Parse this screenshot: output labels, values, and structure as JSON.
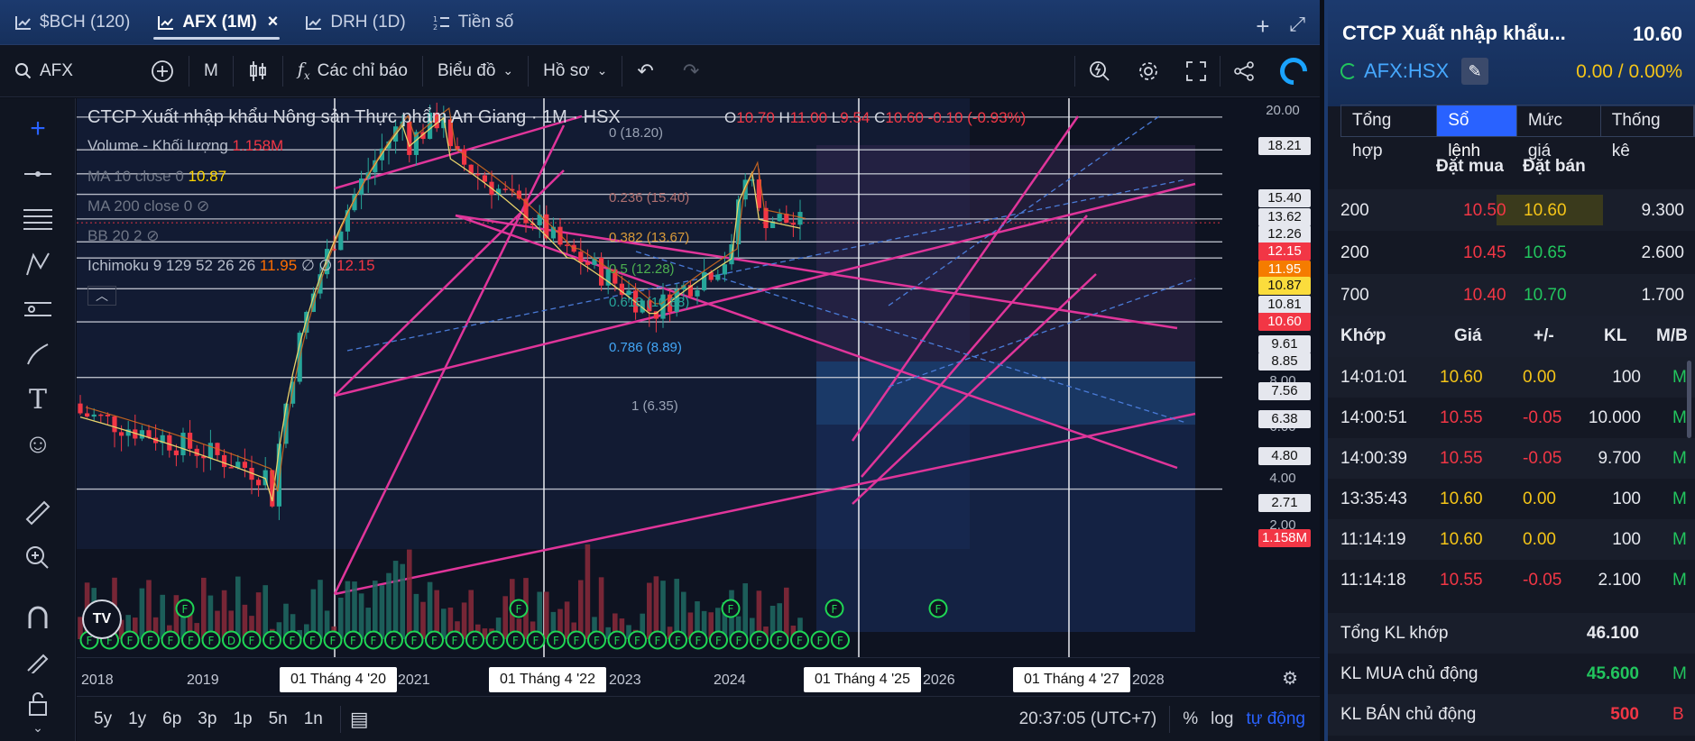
{
  "tabs": [
    {
      "label": "$BCH (120)"
    },
    {
      "label": "AFX (1M)",
      "active": true
    },
    {
      "label": "DRH (1D)"
    },
    {
      "label": "Tiền số"
    }
  ],
  "toolbar": {
    "symbol": "AFX",
    "interval": "M",
    "indicators": "Các chỉ báo",
    "chart_type": "Biểu đồ",
    "profile": "Hồ sơ"
  },
  "legend": {
    "title": "CTCP Xuất nhập khẩu Nông sản Thực phẩm An Giang · 1M · HSX",
    "ohlc": {
      "o_label": "O",
      "o": "10.70",
      "h_label": "H",
      "h": "11.00",
      "l_label": "L",
      "l": "9.54",
      "c_label": "C",
      "c": "10.60",
      "chg": "-0.10 (-0.93%)"
    },
    "volume_label": "Volume - Khối lượng",
    "volume_value": "1.158M",
    "ma10_label": "MA 10 close 0",
    "ma10_value": "10.87",
    "ma200_label": "MA 200 close 0",
    "bb_label": "BB 20 2",
    "ichimoku_label": "Ichimoku 9 129 52 26 26",
    "ichimoku_v1": "11.95",
    "ichimoku_sym1": "∅",
    "ichimoku_sym2": "∅",
    "ichimoku_v2": "12.15"
  },
  "fib_levels": [
    {
      "label": "0 (18.20)",
      "color": "#9aa3b5"
    },
    {
      "label": "0.236 (15.40)",
      "color": "#b07070"
    },
    {
      "label": "0.382 (13.67)",
      "color": "#d89a3a"
    },
    {
      "label": "0.5 (12.28)",
      "color": "#4caf50"
    },
    {
      "label": "0.618 (10.88)",
      "color": "#26a69a"
    },
    {
      "label": "0.786 (8.89)",
      "color": "#42a5f5"
    },
    {
      "label": "1 (6.35)",
      "color": "#9aa3b5"
    }
  ],
  "price_axis": {
    "ticks": [
      "20.00",
      "10.00",
      "8.00",
      "6.00",
      "4.00",
      "2.00"
    ],
    "labels": [
      {
        "text": "18.21",
        "style": "w"
      },
      {
        "text": "15.40",
        "style": "w"
      },
      {
        "text": "13.62",
        "style": "w"
      },
      {
        "text": "12.26",
        "style": "w"
      },
      {
        "text": "12.15",
        "style": "red"
      },
      {
        "text": "11.95",
        "style": "orange"
      },
      {
        "text": "10.87",
        "style": "yel"
      },
      {
        "text": "10.81",
        "style": "w"
      },
      {
        "text": "10.60",
        "style": "red"
      },
      {
        "text": "9.61",
        "style": "w"
      },
      {
        "text": "8.85",
        "style": "w"
      },
      {
        "text": "7.56",
        "style": "w"
      },
      {
        "text": "6.38",
        "style": "w"
      },
      {
        "text": "4.80",
        "style": "w"
      },
      {
        "text": "2.71",
        "style": "w"
      },
      {
        "text": "1.158M",
        "style": "red"
      }
    ]
  },
  "time_axis": {
    "years": [
      "2018",
      "2019",
      "2021",
      "2023",
      "2024",
      "2026",
      "2028"
    ],
    "markers": [
      "01 Tháng 4 '20",
      "01 Tháng 4 '22",
      "01 Tháng 4 '25",
      "01 Tháng 4 '27"
    ]
  },
  "event_badge": "F",
  "dividend_badge": "D",
  "bottom": {
    "timeframes": [
      "5y",
      "1y",
      "6p",
      "3p",
      "1p",
      "5n",
      "1n"
    ],
    "clock": "20:37:05 (UTC+7)",
    "percent": "%",
    "log": "log",
    "auto": "tự động"
  },
  "panel": {
    "name": "CTCP Xuất nhập khẩu...",
    "price": "10.60",
    "symbol": "AFX:HSX",
    "change": "0.00 / 0.00%",
    "tabs": [
      "Tổng hợp",
      "Sổ lệnh",
      "Mức giá",
      "Thống kê"
    ],
    "active_tab": 1,
    "orderbook_head": {
      "buy": "Đặt mua",
      "sell": "Đặt bán"
    },
    "orderbook": [
      {
        "bid_vol": "200",
        "bid": "10.50",
        "ask": "10.60",
        "ask_vol": "9.300"
      },
      {
        "bid_vol": "200",
        "bid": "10.45",
        "ask": "10.65",
        "ask_vol": "2.600"
      },
      {
        "bid_vol": "700",
        "bid": "10.40",
        "ask": "10.70",
        "ask_vol": "1.700"
      }
    ],
    "match_head": {
      "time": "Khớp",
      "price": "Giá",
      "chg": "+/-",
      "vol": "KL",
      "side": "M/B"
    },
    "matches": [
      {
        "time": "14:01:01",
        "price": "10.60",
        "chg": "0.00",
        "vol": "100",
        "side": "M",
        "pc": "y"
      },
      {
        "time": "14:00:51",
        "price": "10.55",
        "chg": "-0.05",
        "vol": "10.000",
        "side": "M",
        "pc": "r"
      },
      {
        "time": "14:00:39",
        "price": "10.55",
        "chg": "-0.05",
        "vol": "9.700",
        "side": "M",
        "pc": "r"
      },
      {
        "time": "13:35:43",
        "price": "10.60",
        "chg": "0.00",
        "vol": "100",
        "side": "M",
        "pc": "y"
      },
      {
        "time": "11:14:19",
        "price": "10.60",
        "chg": "0.00",
        "vol": "100",
        "side": "M",
        "pc": "y"
      },
      {
        "time": "11:14:18",
        "price": "10.55",
        "chg": "-0.05",
        "vol": "2.100",
        "side": "M",
        "pc": "r"
      }
    ],
    "summary": [
      {
        "label": "Tổng KL khớp",
        "value": "46.100",
        "vc": "w",
        "side": ""
      },
      {
        "label": "KL MUA chủ động",
        "value": "45.600",
        "vc": "g",
        "side": "M"
      },
      {
        "label": "KL BÁN chủ động",
        "value": "500",
        "vc": "r",
        "side": "B"
      }
    ]
  }
}
